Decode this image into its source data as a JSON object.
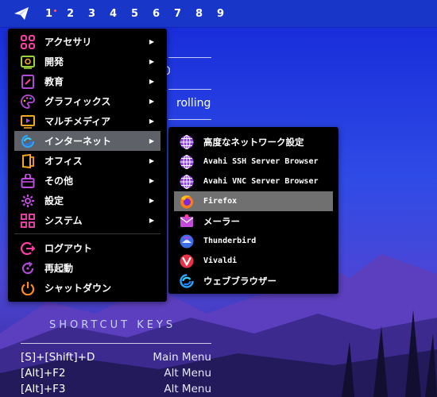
{
  "panel": {
    "workspaces": [
      "1",
      "2",
      "3",
      "4",
      "5",
      "6",
      "7",
      "8",
      "9"
    ],
    "active_workspace": "1"
  },
  "conky": {
    "rolling": "rolling",
    "partial_digit": "0",
    "shortcut_title": "SHORTCUT KEYS",
    "shortcuts": [
      {
        "keys": "[S]+[Shift]+D",
        "action": "Main Menu"
      },
      {
        "keys": "[Alt]+F2",
        "action": "Alt Menu"
      },
      {
        "keys": "[Alt]+F3",
        "action": "Alt Menu"
      }
    ]
  },
  "main_menu": {
    "items": [
      {
        "label": "アクセサリ",
        "icon": "accessories-icon",
        "color": "#ff3ea5"
      },
      {
        "label": "開発",
        "icon": "development-icon",
        "color": "#9bd23a"
      },
      {
        "label": "教育",
        "icon": "education-icon",
        "color": "#b04ad8"
      },
      {
        "label": "グラフィックス",
        "icon": "graphics-icon",
        "color": "#b84ad8"
      },
      {
        "label": "マルチメディア",
        "icon": "multimedia-icon",
        "color": "#f5a623"
      },
      {
        "label": "インターネット",
        "icon": "internet-icon",
        "color": "#2aa5ff"
      },
      {
        "label": "オフィス",
        "icon": "office-icon",
        "color": "#f5a623"
      },
      {
        "label": "その他",
        "icon": "other-icon",
        "color": "#c04ae0"
      },
      {
        "label": "設定",
        "icon": "settings-icon",
        "color": "#c04ae0"
      },
      {
        "label": "システム",
        "icon": "system-icon",
        "color": "#e040a0"
      }
    ],
    "session_items": [
      {
        "label": "ログアウト",
        "icon": "logout-icon",
        "color": "#ff3ea5"
      },
      {
        "label": "再起動",
        "icon": "reboot-icon",
        "color": "#b04ad8"
      },
      {
        "label": "シャットダウン",
        "icon": "shutdown-icon",
        "color": "#ff8c1a"
      }
    ],
    "selected": "インターネット"
  },
  "internet_submenu": {
    "items": [
      {
        "label": "高度なネットワーク設定",
        "icon": "network-globe-icon",
        "jp": true
      },
      {
        "label": "Avahi SSH Server Browser",
        "icon": "network-globe-icon",
        "jp": false
      },
      {
        "label": "Avahi VNC Server Browser",
        "icon": "network-globe-icon",
        "jp": false
      },
      {
        "label": "Firefox",
        "icon": "firefox-icon",
        "jp": false
      },
      {
        "label": "メーラー",
        "icon": "mail-icon",
        "jp": true
      },
      {
        "label": "Thunderbird",
        "icon": "thunderbird-icon",
        "jp": false
      },
      {
        "label": "Vivaldi",
        "icon": "vivaldi-icon",
        "jp": false
      },
      {
        "label": "ウェブブラウザー",
        "icon": "web-browser-icon",
        "jp": true
      }
    ],
    "selected": "Firefox"
  },
  "colors": {
    "panel": "#1837c9",
    "menu_bg": "#000000",
    "selection": "#5f6168"
  }
}
